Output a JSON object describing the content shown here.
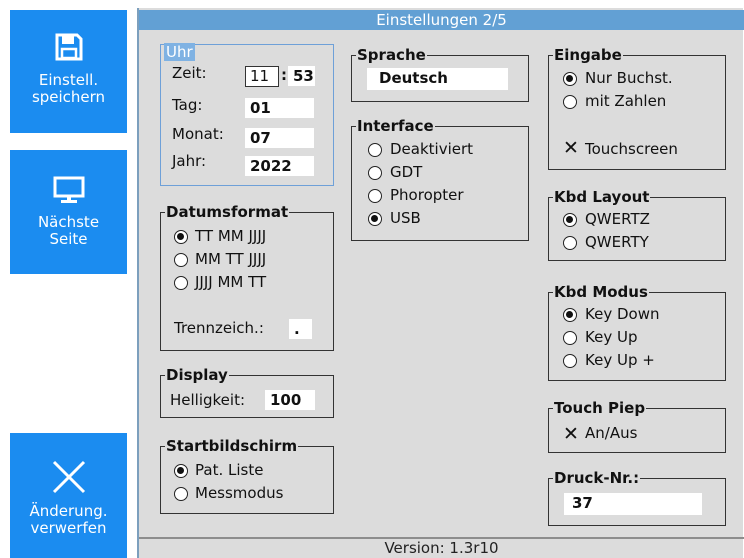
{
  "title": "Einstellungen 2/5",
  "version": "Version: 1.3r10",
  "sidebar": {
    "save": {
      "line1": "Einstell.",
      "line2": "speichern",
      "icon": "floppy-disk-icon"
    },
    "next": {
      "line1": "Nächste",
      "line2": "Seite",
      "icon": "monitor-icon"
    },
    "discard": {
      "line1": "Änderung.",
      "line2": "verwerfen",
      "icon": "close-icon"
    }
  },
  "uhr": {
    "title": "Uhr",
    "zeit_label": "Zeit:",
    "hour": "11",
    "sep": ":",
    "minute": "53",
    "tag_label": "Tag:",
    "tag": "01",
    "monat_label": "Monat:",
    "monat": "07",
    "jahr_label": "Jahr:",
    "jahr": "2022"
  },
  "datumsformat": {
    "title": "Datumsformat",
    "options": [
      "TT MM JJJJ",
      "MM TT JJJJ",
      "JJJJ MM TT"
    ],
    "selected": 0,
    "trenn_label": "Trennzeich.:",
    "trenn_value": "."
  },
  "display": {
    "title": "Display",
    "label": "Helligkeit:",
    "value": "100"
  },
  "startbild": {
    "title": "Startbildschirm",
    "options": [
      "Pat. Liste",
      "Messmodus"
    ],
    "selected": 0
  },
  "sprache": {
    "title": "Sprache",
    "value": "Deutsch"
  },
  "interface": {
    "title": "Interface",
    "options": [
      "Deaktiviert",
      "GDT",
      "Phoropter",
      "USB"
    ],
    "selected": 3
  },
  "eingabe": {
    "title": "Eingabe",
    "options": [
      "Nur Buchst.",
      "mit Zahlen"
    ],
    "selected": 0,
    "touch_label": "Touchscreen",
    "touch_checked": true
  },
  "kbd_layout": {
    "title": "Kbd Layout",
    "options": [
      "QWERTZ",
      "QWERTY"
    ],
    "selected": 0
  },
  "kbd_modus": {
    "title": "Kbd Modus",
    "options": [
      "Key Down",
      "Key Up",
      "Key Up +"
    ],
    "selected": 0
  },
  "touch_piep": {
    "title": "Touch Piep",
    "label": "An/Aus",
    "checked": true
  },
  "druck": {
    "title": "Druck-Nr.:",
    "value": "37"
  },
  "colors": {
    "accent": "#1b8cf0",
    "titlebar": "#62a0d4",
    "panel": "#dcdcdc"
  }
}
